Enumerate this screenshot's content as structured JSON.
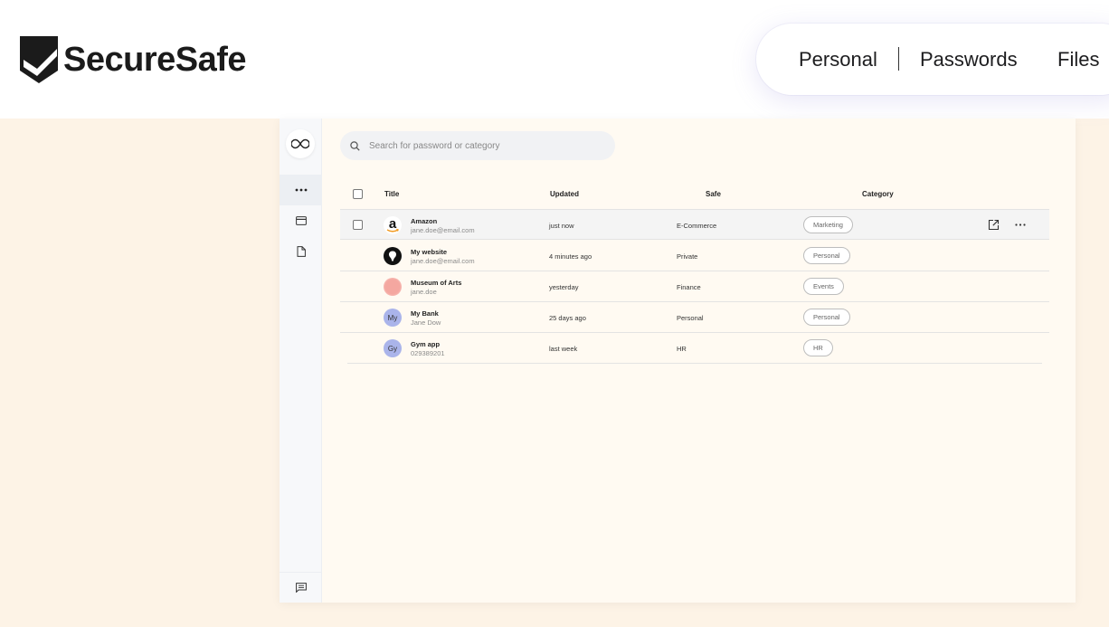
{
  "brand": {
    "name": "SecureSafe"
  },
  "nav": {
    "personal": "Personal",
    "passwords": "Passwords",
    "files": "Files"
  },
  "search": {
    "placeholder": "Search for password or category"
  },
  "table": {
    "headers": {
      "title": "Title",
      "updated": "Updated",
      "safe": "Safe",
      "category": "Category"
    },
    "rows": [
      {
        "title": "Amazon",
        "subtitle": "jane.doe@email.com",
        "updated": "just now",
        "safe": "E-Commerce",
        "category": "Marketing",
        "avatar": "amazon-icon"
      },
      {
        "title": "My website",
        "subtitle": "jane.doe@email.com",
        "updated": "4 minutes ago",
        "safe": "Private",
        "category": "Personal",
        "avatar": "website-icon"
      },
      {
        "title": "Museum of Arts",
        "subtitle": "jane.doe",
        "updated": "yesterday",
        "safe": "Finance",
        "category": "Events",
        "avatar": "museum-icon"
      },
      {
        "title": "My Bank",
        "subtitle": "Jane Dow",
        "updated": "25 days ago",
        "safe": "Personal",
        "category": "Personal",
        "avatar_text": "My"
      },
      {
        "title": "Gym app",
        "subtitle": "029389201",
        "updated": "last week",
        "safe": "HR",
        "category": "HR",
        "avatar_text": "Gy"
      }
    ]
  },
  "colors": {
    "page_bg": "#fdf3e6",
    "avatar_purple": "#aab4ea",
    "museum_pink": "#f4a7a0"
  }
}
